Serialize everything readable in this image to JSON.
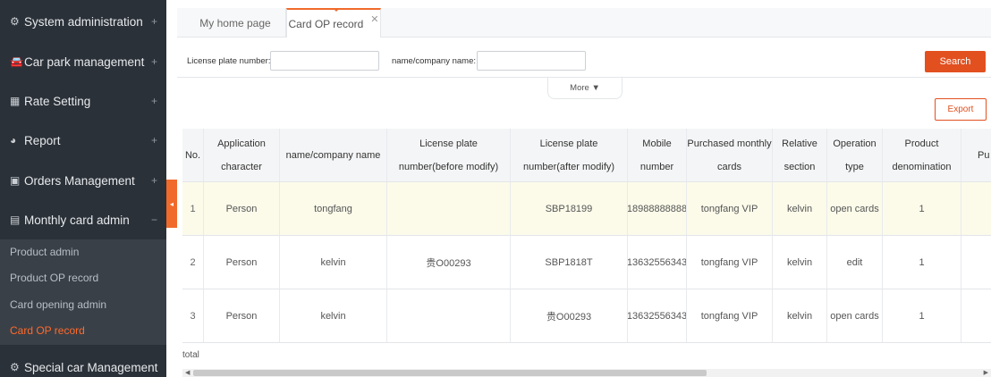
{
  "sidebar": {
    "items": [
      {
        "icon": "⚙",
        "label": "System administration",
        "sign": "+"
      },
      {
        "icon": "🚘",
        "label": "Car park management",
        "sign": "+"
      },
      {
        "icon": "▦",
        "label": "Rate Setting",
        "sign": "+"
      },
      {
        "icon": "◕",
        "label": "Report",
        "sign": "+"
      },
      {
        "icon": "▣",
        "label": "Orders Management",
        "sign": "+"
      },
      {
        "icon": "▤",
        "label": "Monthly card admin",
        "sign": "−"
      },
      {
        "icon": "⚙",
        "label": "Special car Management",
        "sign": ""
      }
    ],
    "sub_items": [
      "Product admin",
      "Product OP record",
      "Card opening admin",
      "Card OP record"
    ],
    "collapse_glyph": "◂"
  },
  "tabs": [
    {
      "label": "My home page"
    },
    {
      "label": "Card OP record",
      "close": "✕"
    }
  ],
  "filters": {
    "plate_label": "License plate number:",
    "plate_value": "",
    "name_label": "name/company name:",
    "name_value": "",
    "search_label": "Search",
    "more_label": "More ▼",
    "export_label": "Export"
  },
  "table": {
    "headers": [
      "No.",
      "Application character",
      "name/company name",
      "License plate number(before modify)",
      "License plate number(after modify)",
      "Mobile number",
      "Purchased monthly cards",
      "Relative section",
      "Operation type",
      "Product denomination",
      "Pu qu"
    ],
    "rows": [
      [
        "1",
        "Person",
        "tongfang",
        "",
        "SBP18199",
        "18988888888",
        "tongfang VIP",
        "kelvin",
        "open cards",
        "1",
        ""
      ],
      [
        "2",
        "Person",
        "kelvin",
        "贵O00293",
        "SBP1818T",
        "13632556343",
        "tongfang VIP",
        "kelvin",
        "edit",
        "1",
        ""
      ],
      [
        "3",
        "Person",
        "kelvin",
        "",
        "贵O00293",
        "13632556343",
        "tongfang VIP",
        "kelvin",
        "open cards",
        "1",
        ""
      ]
    ],
    "total_label": "total"
  },
  "colors": {
    "accent": "#e2501f",
    "sidebar_bg": "#2b3138",
    "highlight_row": "#fcfbea"
  }
}
